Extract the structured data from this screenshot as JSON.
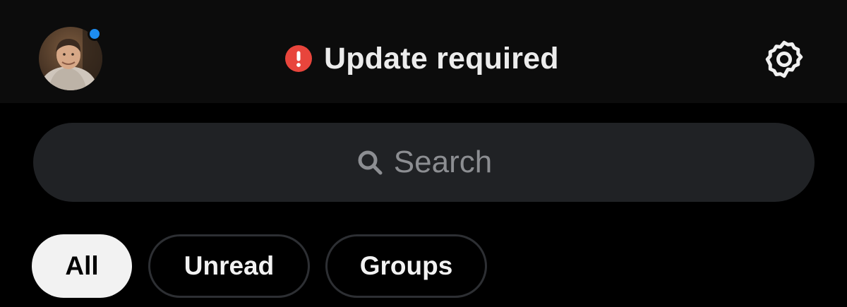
{
  "header": {
    "avatar": {
      "alt": "Profile photo",
      "has_presence_dot": true,
      "presence_color": "#1d8cf0"
    },
    "status": {
      "icon": "alert-circle-icon",
      "icon_color": "#e8453c",
      "title": "Update required"
    },
    "settings": {
      "icon": "gear-icon"
    }
  },
  "search": {
    "icon": "search-icon",
    "placeholder": "Search"
  },
  "filters": {
    "chips": [
      {
        "label": "All",
        "selected": true
      },
      {
        "label": "Unread",
        "selected": false
      },
      {
        "label": "Groups",
        "selected": false
      }
    ]
  },
  "colors": {
    "background": "#000000",
    "header_background": "#0c0c0c",
    "search_background": "#202225",
    "accent_alert": "#e8453c",
    "presence": "#1d8cf0"
  }
}
